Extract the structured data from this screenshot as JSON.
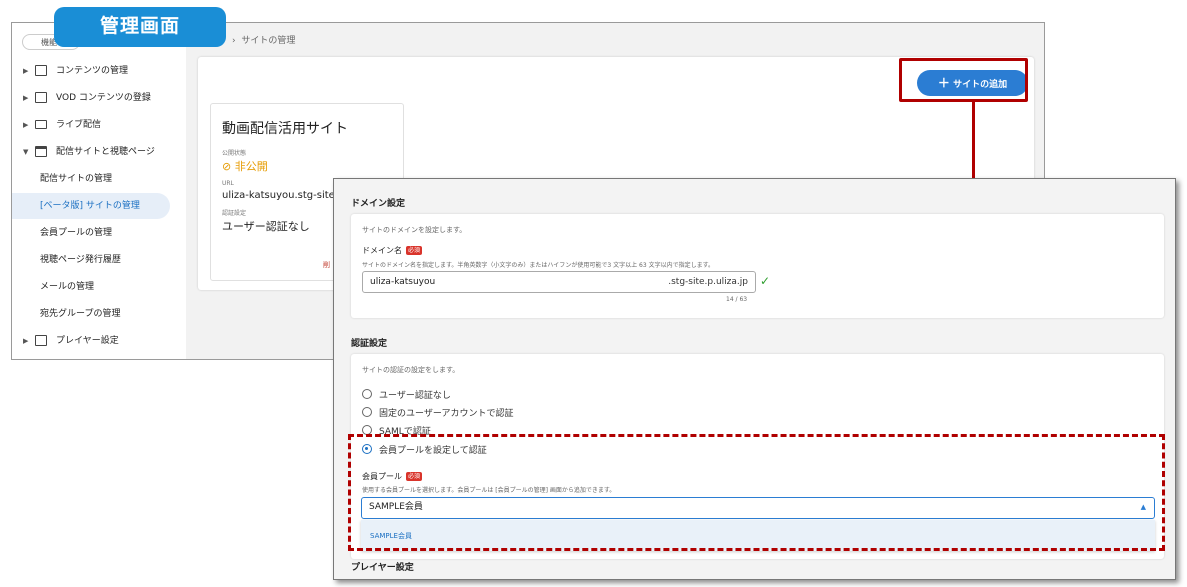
{
  "badge": {
    "label": "管理画面"
  },
  "back": {
    "search_label": "機能",
    "breadcrumb": "サイトの管理",
    "sidebar": {
      "items": [
        {
          "label": "コンテンツの管理"
        },
        {
          "label": "VOD コンテンツの登録"
        },
        {
          "label": "ライブ配信"
        },
        {
          "label": "配信サイトと視聴ページ"
        },
        {
          "label": "配信サイトの管理"
        },
        {
          "label": "[ベータ版] サイトの管理"
        },
        {
          "label": "会員プールの管理"
        },
        {
          "label": "視聴ページ発行履歴"
        },
        {
          "label": "メールの管理"
        },
        {
          "label": "宛先グループの管理"
        },
        {
          "label": "プレイヤー設定"
        }
      ]
    },
    "add_site_label": "サイトの追加",
    "site_card": {
      "title": "動画配信活用サイト",
      "status_label": "公開状態",
      "status_value": "非公開",
      "url_label": "URL",
      "url_value": "uliza-katsuyou.stg-site.p",
      "auth_label": "認証設定",
      "auth_value": "ユーザー認証なし",
      "delete_label": "削"
    }
  },
  "front": {
    "domain_section": {
      "title": "ドメイン設定",
      "desc": "サイトのドメインを設定します。",
      "field_label": "ドメイン名",
      "required": "必須",
      "hint": "サイトのドメイン名を指定します。半角英数字（小文字のみ）またはハイフンが使用可能で3 文字以上 63 文字以内で指定します。",
      "value": "uliza-katsuyou",
      "suffix": ".stg-site.p.uliza.jp",
      "count": "14 / 63"
    },
    "auth_section": {
      "title": "認証設定",
      "desc": "サイトの認証の設定をします。",
      "options": [
        {
          "label": "ユーザー認証なし",
          "checked": false
        },
        {
          "label": "固定のユーザーアカウントで認証",
          "checked": false
        },
        {
          "label": "SAMLで認証",
          "checked": false
        },
        {
          "label": "会員プールを設定して認証",
          "checked": true
        }
      ],
      "pool_label": "会員プール",
      "required": "必須",
      "pool_hint": "使用する会員プールを選択します。会員プールは [会員プールの管理] 画面から追加できます。",
      "pool_value": "SAMPLE会員",
      "pool_option": "SAMPLE会員"
    },
    "player_section": {
      "title": "プレイヤー設定"
    }
  },
  "colors": {
    "accent": "#2b7dd3",
    "highlight": "#b00000",
    "badge": "#1a8ed6"
  }
}
